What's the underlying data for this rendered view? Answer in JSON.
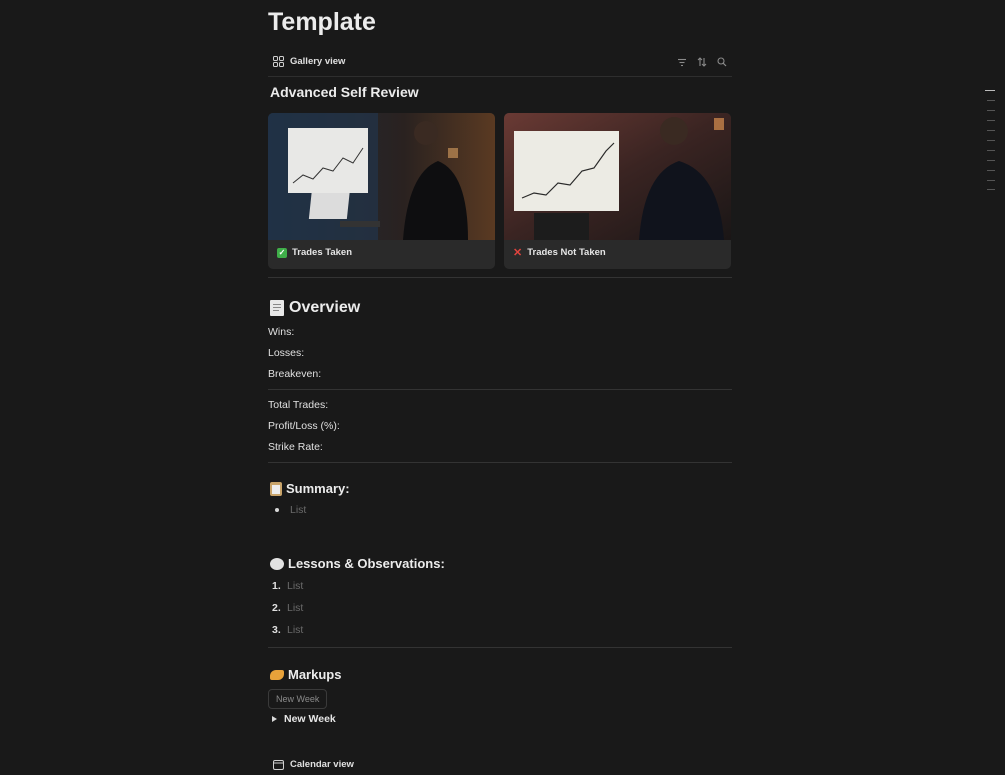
{
  "page": {
    "title": "Template"
  },
  "view": {
    "label": "Gallery view",
    "icon": "gallery-grid-icon"
  },
  "gallery": {
    "title": "Advanced Self Review",
    "cards": [
      {
        "label": "Trades Taken",
        "icon": "check-mark-icon",
        "icon_color": "#3fae49"
      },
      {
        "label": "Trades Not Taken",
        "icon": "cross-mark-icon",
        "icon_color": "#e0443e"
      }
    ]
  },
  "overview": {
    "heading": "Overview",
    "icon": "receipt-icon",
    "fields": [
      "Wins:",
      "Losses:",
      "Breakeven:"
    ],
    "fields2": [
      "Total Trades:",
      "Profit/Loss (%):",
      "Strike Rate:"
    ]
  },
  "summary": {
    "heading": "Summary:",
    "icon": "clipboard-icon",
    "items": [
      "List"
    ]
  },
  "lessons": {
    "heading": "Lessons & Observations:",
    "icon": "thought-bubble-icon",
    "numbers": [
      "1.",
      "2.",
      "3."
    ],
    "items": [
      "List",
      "List",
      "List"
    ]
  },
  "markups": {
    "heading": "Markups",
    "icon": "writing-hand-icon",
    "button_label": "New Week",
    "toggle_label": "New Week"
  },
  "calendar": {
    "label": "Calendar view",
    "icon": "calendar-icon"
  },
  "colors": {
    "background": "#191919",
    "card": "#2a2a2a",
    "placeholder": "#6a6a6a"
  }
}
